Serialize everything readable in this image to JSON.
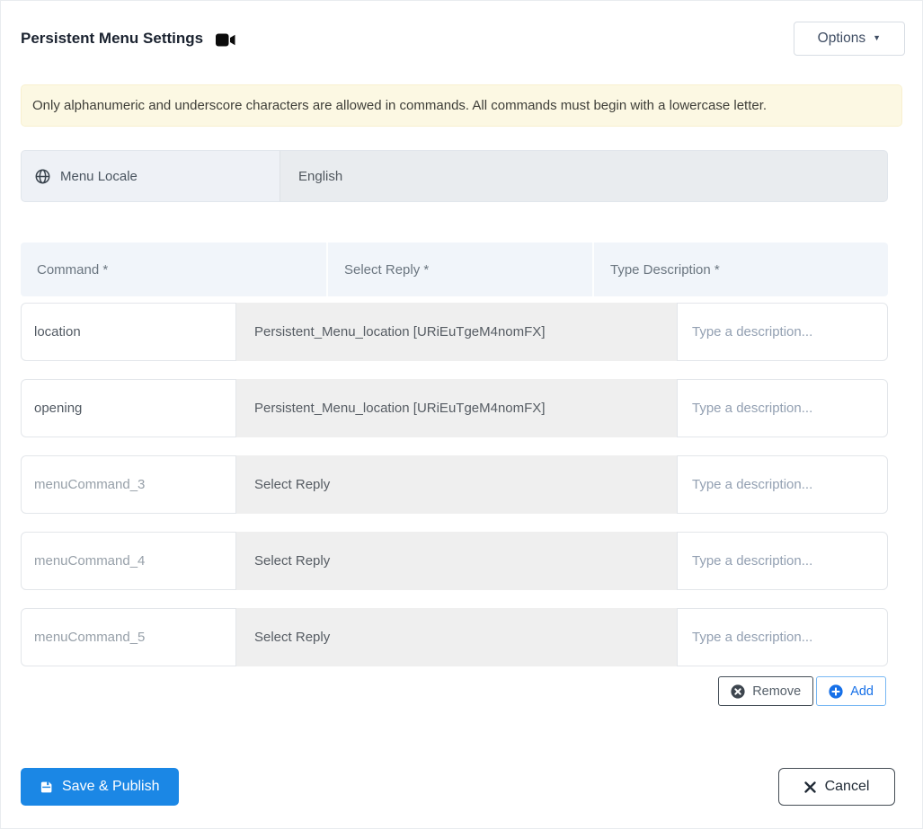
{
  "header": {
    "title": "Persistent Menu Settings",
    "options_label": "Options"
  },
  "banner": {
    "text": "Only alphanumeric and underscore characters are allowed in commands. All commands must begin with a lowercase letter."
  },
  "locale": {
    "label": "Menu Locale",
    "value": "English"
  },
  "table": {
    "columns": [
      "Command *",
      "Select Reply *",
      "Type Description *"
    ],
    "description_placeholder": "Type a description...",
    "rows": [
      {
        "command": "location",
        "command_state": "filled",
        "reply": "Persistent_Menu_location [URiEuTgeM4nomFX]",
        "description": ""
      },
      {
        "command": "opening",
        "command_state": "filled",
        "reply": "Persistent_Menu_location [URiEuTgeM4nomFX]",
        "description": ""
      },
      {
        "command": "menuCommand_3",
        "command_state": "placeholder",
        "reply": "Select Reply",
        "description": ""
      },
      {
        "command": "menuCommand_4",
        "command_state": "placeholder",
        "reply": "Select Reply",
        "description": ""
      },
      {
        "command": "menuCommand_5",
        "command_state": "placeholder",
        "reply": "Select Reply",
        "description": ""
      }
    ]
  },
  "row_actions": {
    "remove_label": "Remove",
    "add_label": "Add"
  },
  "footer": {
    "save_label": "Save & Publish",
    "cancel_label": "Cancel"
  },
  "icons": {
    "caret_down": "▼",
    "video_camera": "video-camera",
    "globe": "globe",
    "x_circle": "x-circle",
    "plus_circle": "plus-circle",
    "save": "floppy-disk",
    "close": "x-mark"
  },
  "colors": {
    "primary_blue": "#1b87e5",
    "add_blue": "#1670e8",
    "banner_bg": "#fcf8e3",
    "table_header_bg": "#f1f5fa",
    "reply_bg": "#efefef",
    "locale_label_bg": "#eef1f6",
    "locale_value_bg": "#e9ecef"
  }
}
